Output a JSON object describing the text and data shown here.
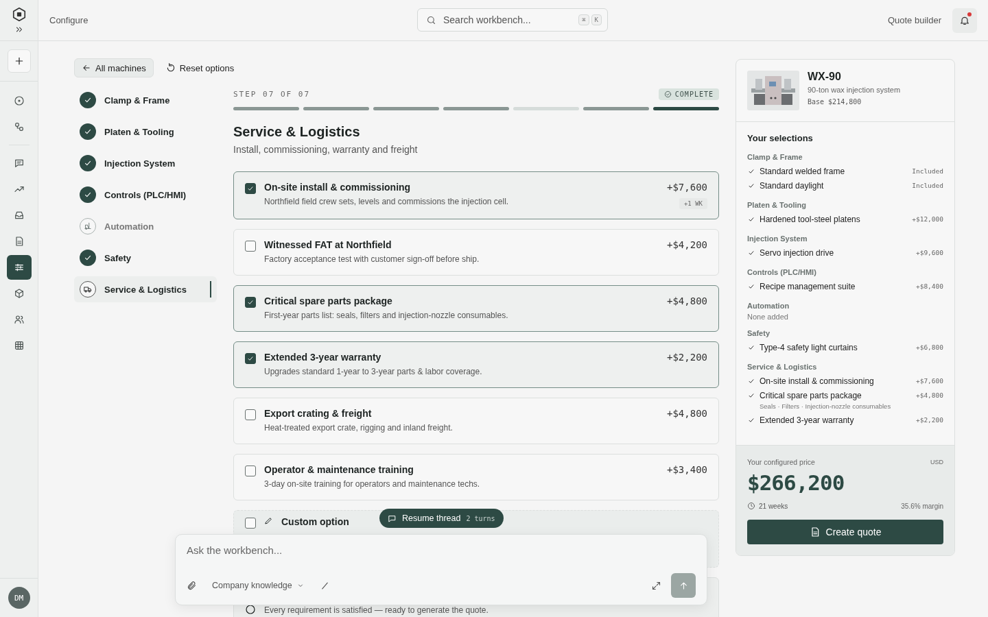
{
  "rail": {
    "items": [
      {
        "selected": false
      },
      {
        "selected": false
      },
      {
        "selected": false
      },
      {
        "selected": false
      },
      {
        "selected": false
      },
      {
        "selected": false
      },
      {
        "selected": true
      },
      {
        "selected": false
      },
      {
        "selected": false
      },
      {
        "selected": false
      }
    ],
    "avatar": "DM"
  },
  "header": {
    "title": "Configure",
    "search": {
      "placeholder": "Search workbench...",
      "keys": [
        "⌘",
        "K"
      ]
    },
    "link": "Quote builder",
    "unread": true
  },
  "toolbar": {
    "back": "All machines",
    "reset": "Reset options"
  },
  "steps": [
    {
      "label": "Clamp & Frame",
      "done": true,
      "selected": false
    },
    {
      "label": "Platen & Tooling",
      "done": true,
      "selected": false
    },
    {
      "label": "Injection System",
      "done": true,
      "selected": false
    },
    {
      "label": "Controls (PLC/HMI)",
      "done": true,
      "selected": false
    },
    {
      "label": "Automation",
      "done": false,
      "selected": false
    },
    {
      "label": "Safety",
      "done": true,
      "selected": false
    },
    {
      "label": "Service & Logistics",
      "done": true,
      "selected": true
    }
  ],
  "step_counter": "STEP 07 OF 07",
  "status_badge": "COMPLETE",
  "section": {
    "title": "Service & Logistics",
    "subtitle": "Install, commissioning, warranty and freight"
  },
  "options": [
    {
      "kind": "option",
      "title": "On-site install & commissioning",
      "description": "Northfield field crew sets, levels and commissions the injection cell.",
      "price": "+$7,600",
      "lead": "+1 WK",
      "checked": true
    },
    {
      "kind": "option",
      "title": "Witnessed FAT at Northfield",
      "description": "Factory acceptance test with customer sign-off before ship.",
      "price": "+$4,200",
      "checked": false
    },
    {
      "kind": "option",
      "title": "Critical spare parts package",
      "description": "First-year parts list: seals, filters and injection-nozzle consumables.",
      "price": "+$4,800",
      "checked": true
    },
    {
      "kind": "option",
      "title": "Extended 3-year warranty",
      "description": "Upgrades standard 1-year to 3-year parts & labor coverage.",
      "price": "+$2,200",
      "checked": true
    },
    {
      "kind": "option",
      "title": "Export crating & freight",
      "description": "Heat-treated export crate, rigging and inland freight.",
      "price": "+$4,800",
      "checked": false
    },
    {
      "kind": "option",
      "title": "Operator & maintenance training",
      "description": "3-day on-site training for operators and maintenance techs.",
      "price": "+$3,400",
      "checked": false
    },
    {
      "kind": "custom",
      "title": "Custom option",
      "checked": false
    },
    {
      "kind": "notice",
      "description": "Every requirement is satisfied — ready to generate the quote."
    }
  ],
  "resume": {
    "label": "Resume thread",
    "count": "2 turns"
  },
  "composer": {
    "placeholder": "Ask the workbench...",
    "source": "Company knowledge"
  },
  "summary": {
    "model": "WX-90",
    "subtitle": "90-ton wax injection system",
    "base": "Base $214,800",
    "heading": "Your selections",
    "groups": [
      {
        "name": "Clamp & Frame",
        "items": [
          {
            "label": "Standard welded frame",
            "price": "Included"
          },
          {
            "label": "Standard daylight",
            "price": "Included"
          }
        ]
      },
      {
        "name": "Platen & Tooling",
        "items": [
          {
            "label": "Hardened tool-steel platens",
            "price": "+$12,000"
          }
        ]
      },
      {
        "name": "Injection System",
        "items": [
          {
            "label": "Servo injection drive",
            "price": "+$9,600"
          }
        ]
      },
      {
        "name": "Controls (PLC/HMI)",
        "items": [
          {
            "label": "Recipe management suite",
            "price": "+$8,400"
          }
        ]
      },
      {
        "name": "Automation",
        "empty": "None added"
      },
      {
        "name": "Safety",
        "items": [
          {
            "label": "Type-4 safety light curtains",
            "price": "+$6,800"
          }
        ]
      },
      {
        "name": "Service & Logistics",
        "items": [
          {
            "label": "On-site install & commissioning",
            "price": "+$7,600"
          },
          {
            "label": "Critical spare parts package",
            "price": "+$4,800",
            "note": "Seals · Filters · Injection-nozzle consumables"
          },
          {
            "label": "Extended 3-year warranty",
            "price": "+$2,200"
          }
        ]
      }
    ],
    "price_label": "Your configured price",
    "currency": "USD",
    "total": "$266,200",
    "lead_time": "21 weeks",
    "margin": "35.6% margin",
    "action": "Create quote"
  }
}
